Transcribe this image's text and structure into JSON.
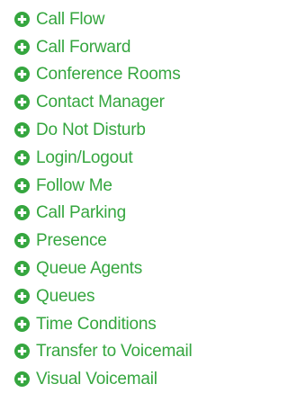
{
  "accent_color": "#35a63f",
  "icon_name": "plus-circle-icon",
  "features": [
    {
      "label": "Call Flow"
    },
    {
      "label": "Call Forward"
    },
    {
      "label": "Conference Rooms"
    },
    {
      "label": "Contact Manager"
    },
    {
      "label": "Do Not Disturb"
    },
    {
      "label": "Login/Logout"
    },
    {
      "label": "Follow Me"
    },
    {
      "label": "Call Parking"
    },
    {
      "label": "Presence"
    },
    {
      "label": "Queue Agents"
    },
    {
      "label": "Queues"
    },
    {
      "label": "Time Conditions"
    },
    {
      "label": "Transfer to Voicemail"
    },
    {
      "label": "Visual Voicemail"
    }
  ]
}
